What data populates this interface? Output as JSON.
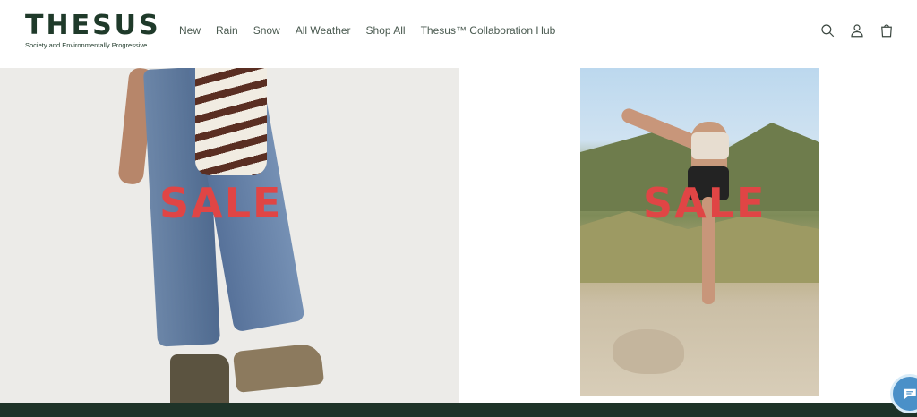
{
  "brand": {
    "name": "THESUS",
    "tagline": "Society and Environmentally Progressive"
  },
  "nav": {
    "items": [
      {
        "label": "New"
      },
      {
        "label": "Rain"
      },
      {
        "label": "Snow"
      },
      {
        "label": "All Weather"
      },
      {
        "label": "Shop All"
      },
      {
        "label": "Thesus™ Collaboration Hub"
      }
    ]
  },
  "header_icons": [
    "search-icon",
    "account-icon",
    "cart-icon"
  ],
  "hero": {
    "left_label": "SALE",
    "right_label": "SALE"
  },
  "colors": {
    "brand_green": "#1f3a2a",
    "sale_red": "#e04545",
    "footer_green": "#1e3328",
    "chat_blue": "#4a90c8"
  },
  "chat": {
    "icon": "chat-icon"
  }
}
